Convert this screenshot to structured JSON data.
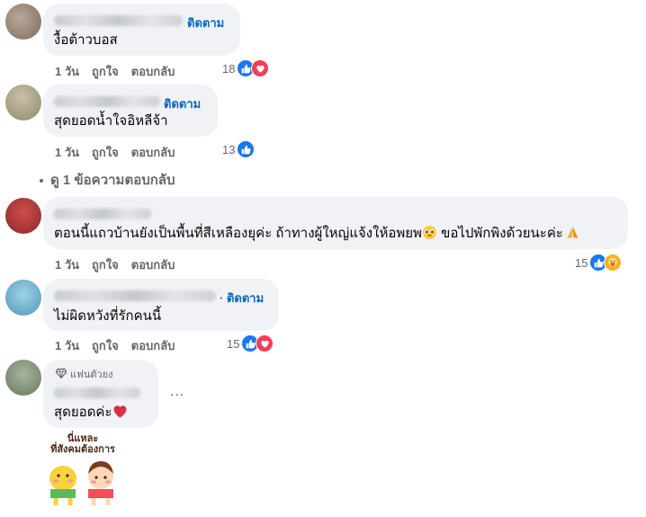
{
  "comments": [
    {
      "follow_label": "ติดตาม",
      "text": "งื้อต้าวบอส",
      "time": "1 วัน",
      "like_label": "ถูกใจ",
      "reply_label": "ตอบกลับ",
      "reaction_count": "18",
      "reactions": [
        "like-icon",
        "love-icon"
      ]
    },
    {
      "follow_label": "ติดตาม",
      "text": "สุดยอดน้ำใจอิหลีจ้า",
      "time": "1 วัน",
      "like_label": "ถูกใจ",
      "reply_label": "ตอบกลับ",
      "reaction_count": "13",
      "reactions": [
        "like-icon"
      ]
    },
    {
      "text": "ตอนนี้แถวบ้านยังเป็นพื้นที่สีเหลืองยุค่ะ ถ้าทางผู้ใหญ่แจ้งให้อพยพ",
      "text_after_emoji": " ขอไปพักพิงด้วยนะค่ะ",
      "time": "1 วัน",
      "like_label": "ถูกใจ",
      "reply_label": "ตอบกลับ",
      "reaction_count": "15",
      "reactions": [
        "like-icon",
        "care-icon"
      ]
    },
    {
      "follow_label": "ติดตาม",
      "text": "ไม่ผิดหวังที่รักคนนี้",
      "time": "1 วัน",
      "like_label": "ถูกใจ",
      "reply_label": "ตอบกลับ",
      "reaction_count": "15",
      "reactions": [
        "like-icon",
        "love-icon"
      ]
    },
    {
      "badge": "แฟนตัวยง",
      "text": "สุดยอดค่ะ",
      "more": "..."
    }
  ],
  "view_replies": "ดู 1 ข้อความตอบกลับ",
  "sticker": {
    "text_line1": "นี่แหละ",
    "text_line2": "ที่สังคมต้องการ"
  },
  "colors": {
    "link": "#0a66c2",
    "like": "#1877f2",
    "love": "#f33e58",
    "bubble": "#f0f2f5",
    "secondary_text": "#65676b"
  }
}
